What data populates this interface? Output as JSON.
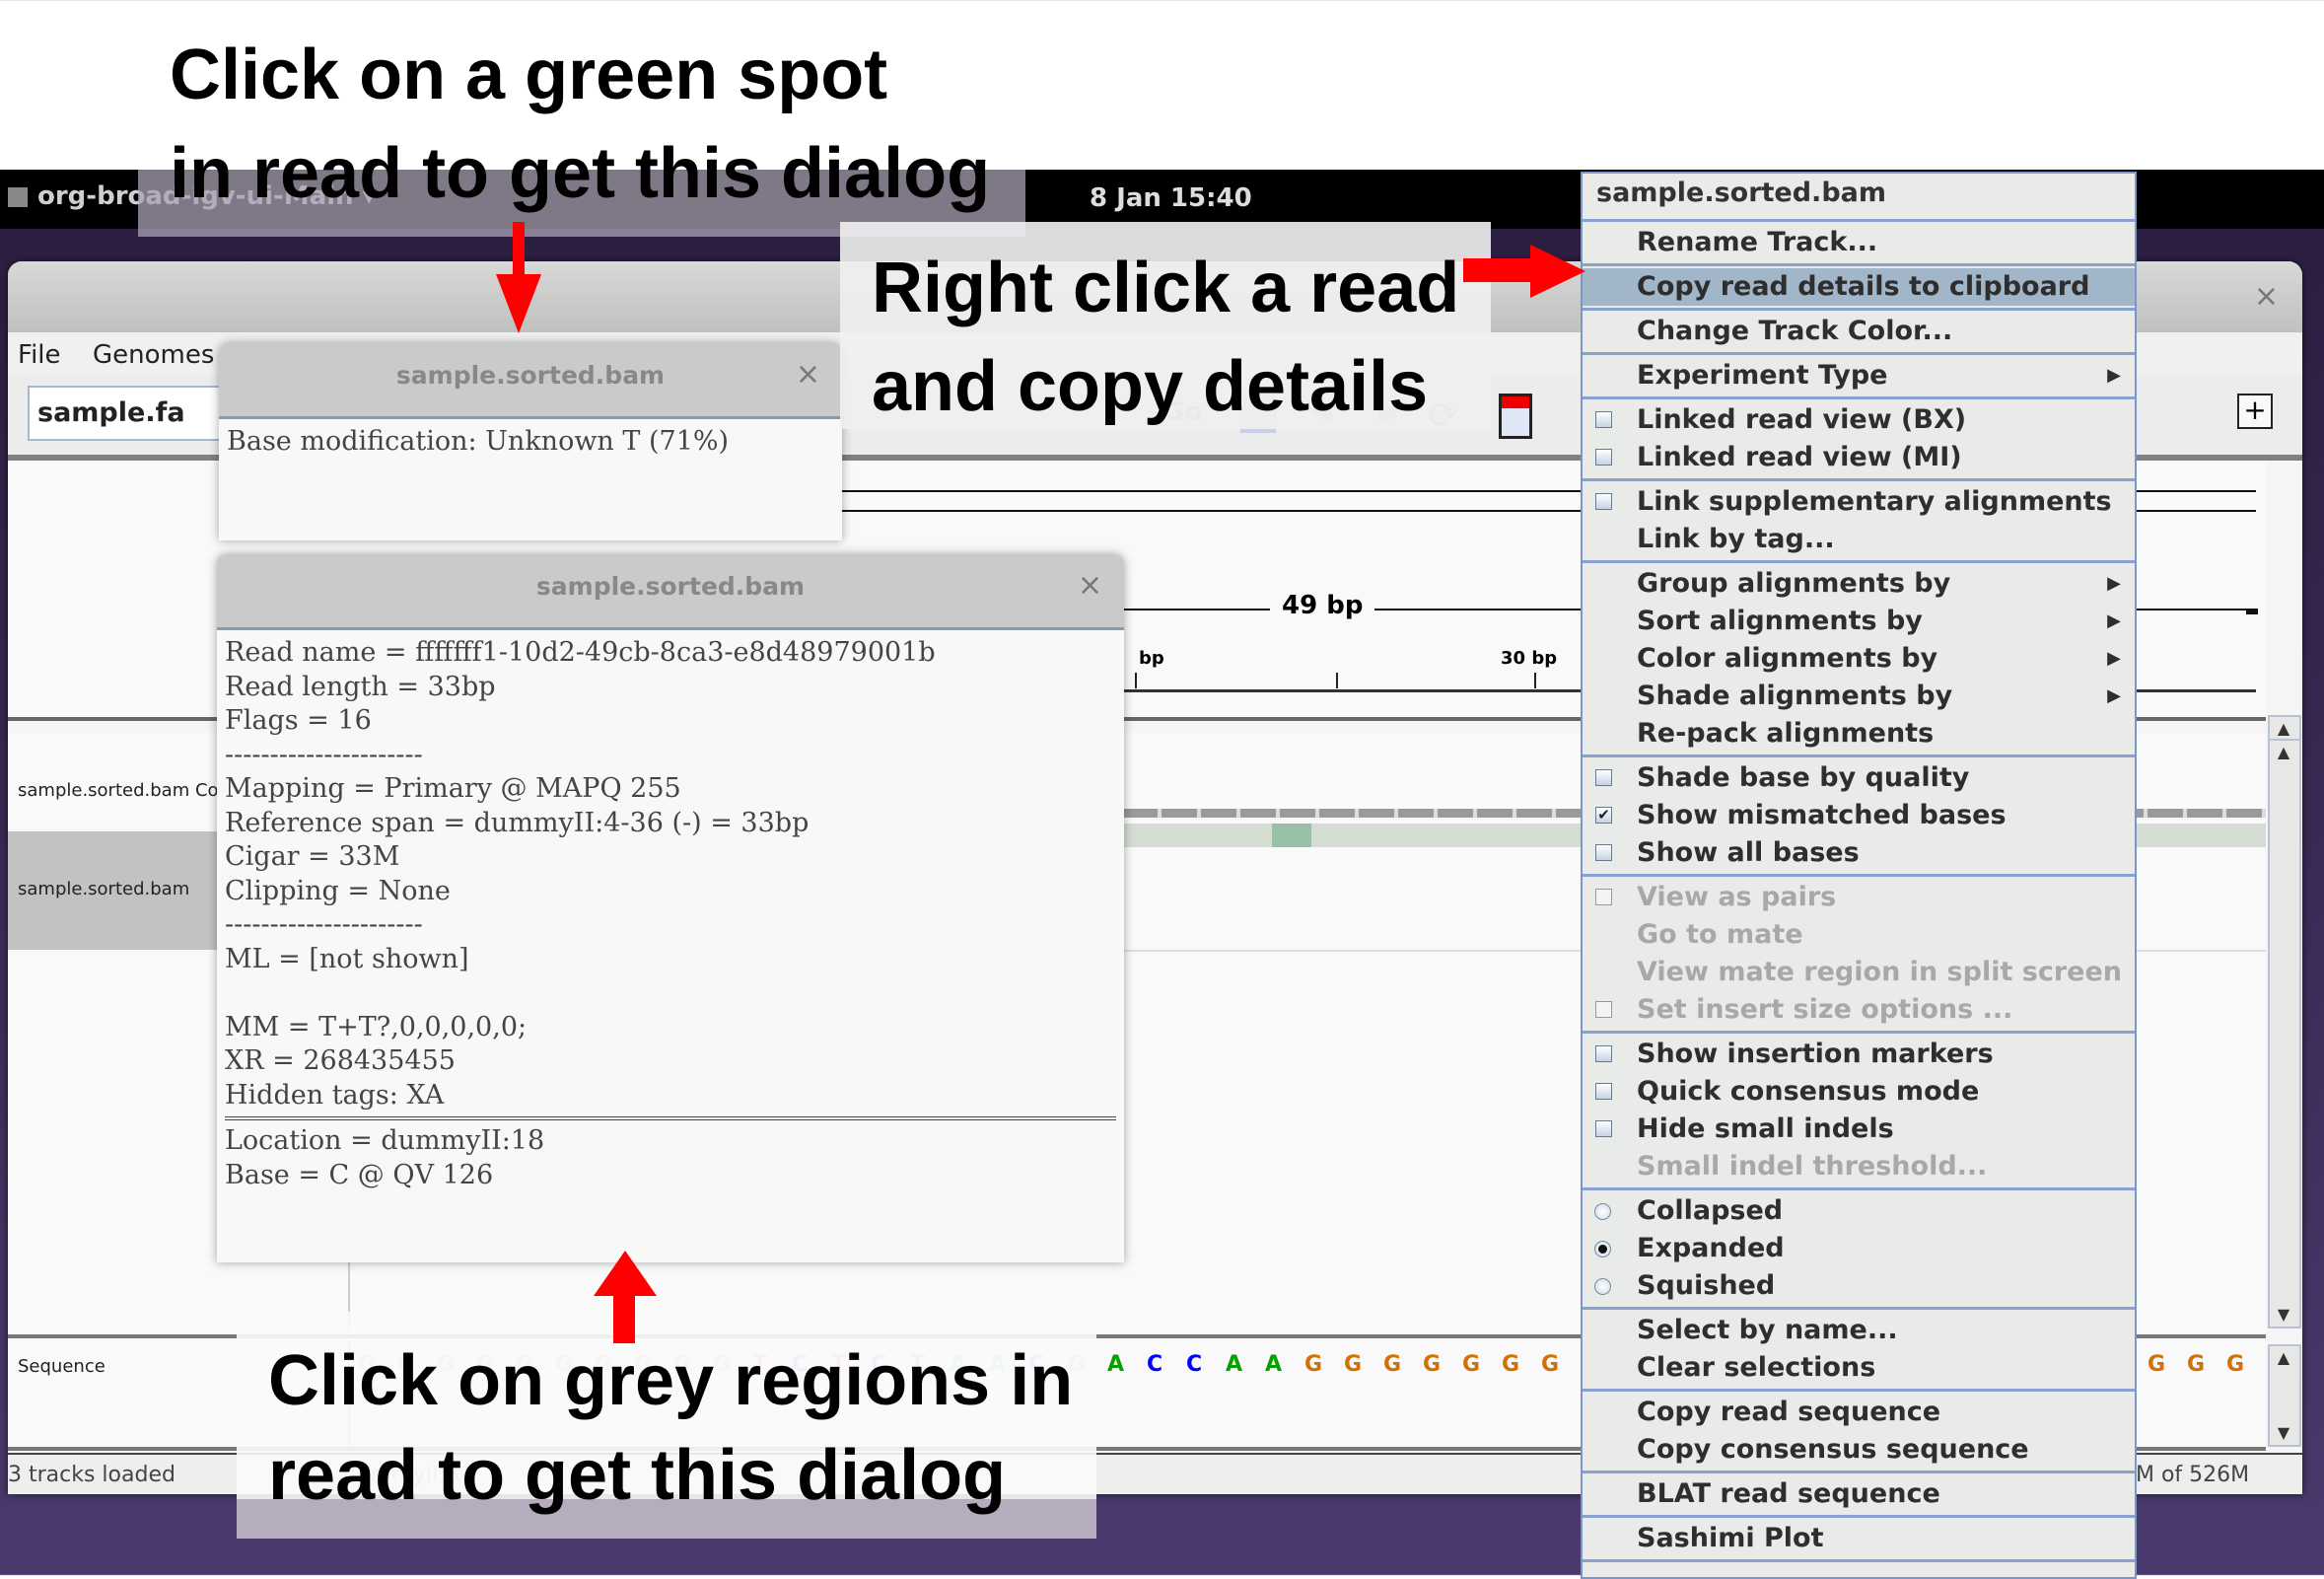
{
  "desktop": {
    "app_name": "org-broad-igv-ui-Main",
    "clock": "8 Jan  15:40"
  },
  "window": {
    "close_glyph": "×",
    "menu": [
      "File",
      "Genomes"
    ],
    "genome": "sample.fa",
    "go_label": "Go",
    "add_glyph": "+"
  },
  "ruler": {
    "span_label": "49 bp",
    "tick_labels": [
      "bp",
      "30 bp"
    ]
  },
  "tracks": [
    {
      "name": "sample.sorted.bam Coverage"
    },
    {
      "name": "sample.sorted.bam"
    },
    {
      "name": "Sequence"
    }
  ],
  "sequence": {
    "bases": [
      "G",
      "G",
      "G",
      "G",
      "G",
      "G",
      "G",
      "G",
      "G",
      "G",
      "T",
      "C",
      "T",
      "C",
      "T",
      "A",
      "A",
      "C",
      "G",
      "A",
      "C",
      "C",
      "A",
      "A",
      "G",
      "G",
      "G",
      "G",
      "G",
      "G",
      "G"
    ],
    "right_bases": [
      "G",
      "G",
      "G"
    ],
    "colors": {
      "A": "#00a000",
      "C": "#0000ff",
      "G": "#d17105",
      "T": "#ff0000"
    }
  },
  "status": {
    "left": "3 tracks loaded",
    "locus": "dummyII:31",
    "memory": "M of 526M"
  },
  "dialog_small": {
    "title": "sample.sorted.bam",
    "close_glyph": "×",
    "text": "Base modification: Unknown T (71%)"
  },
  "dialog_large": {
    "title": "sample.sorted.bam",
    "close_glyph": "×",
    "lines_top": [
      "Read name = fffffff1-10d2-49cb-8ca3-e8d48979001b",
      "Read length = 33bp",
      "Flags = 16",
      "----------------------",
      "Mapping = Primary @ MAPQ 255",
      "Reference span = dummyII:4-36 (-) = 33bp",
      "Cigar = 33M",
      "Clipping = None",
      "----------------------",
      "ML = [not shown]",
      "",
      "MM = T+T?,0,0,0,0,0;",
      "XR = 268435455",
      "Hidden tags: XA"
    ],
    "lines_bottom": [
      "Location = dummyII:18",
      "Base = C @ QV 126"
    ]
  },
  "context_menu": {
    "header": "sample.sorted.bam",
    "groups": [
      [
        {
          "label": "Rename Track..."
        }
      ],
      [
        {
          "label": "Copy read details to clipboard",
          "highlighted": true
        }
      ],
      [
        {
          "label": "Change Track Color..."
        }
      ],
      [
        {
          "label": "Experiment Type",
          "submenu": true
        }
      ],
      [
        {
          "label": "Linked read view (BX)",
          "check": false
        },
        {
          "label": "Linked read view (MI)",
          "check": false
        }
      ],
      [
        {
          "label": "Link supplementary alignments",
          "check": false
        },
        {
          "label": "Link by tag..."
        }
      ],
      [
        {
          "label": "Group alignments by",
          "submenu": true
        },
        {
          "label": "Sort alignments by",
          "submenu": true
        },
        {
          "label": "Color alignments by",
          "submenu": true
        },
        {
          "label": "Shade alignments by",
          "submenu": true
        },
        {
          "label": "Re-pack alignments"
        }
      ],
      [
        {
          "label": "Shade base by quality",
          "check": false
        },
        {
          "label": "Show mismatched bases",
          "check": true
        },
        {
          "label": "Show all bases",
          "check": false
        }
      ],
      [
        {
          "label": "View as pairs",
          "check": false,
          "disabled": true
        },
        {
          "label": "Go to mate",
          "disabled": true
        },
        {
          "label": "View mate region in split screen",
          "disabled": true
        },
        {
          "label": "Set insert size options ...",
          "check": false,
          "disabled": true
        }
      ],
      [
        {
          "label": "Show insertion markers",
          "check": false
        },
        {
          "label": "Quick consensus mode",
          "check": false
        },
        {
          "label": "Hide small indels",
          "check": false
        },
        {
          "label": "Small indel threshold...",
          "disabled": true
        }
      ],
      [
        {
          "label": "Collapsed",
          "radio": false
        },
        {
          "label": "Expanded",
          "radio": true
        },
        {
          "label": "Squished",
          "radio": false
        }
      ],
      [
        {
          "label": "Select by name..."
        },
        {
          "label": "Clear selections"
        }
      ],
      [
        {
          "label": "Copy read sequence"
        },
        {
          "label": "Copy consensus sequence"
        }
      ],
      [
        {
          "label": "BLAT read sequence"
        }
      ],
      [
        {
          "label": "Sashimi Plot"
        }
      ]
    ]
  },
  "annotations": {
    "top_left": [
      "Click on a green spot",
      "in read to get this dialog"
    ],
    "top_right": [
      "Right click a read",
      "and copy details"
    ],
    "bottom": [
      "Click on grey regions in",
      "read to get this dialog"
    ],
    "arrow_color": "#ff0000"
  }
}
